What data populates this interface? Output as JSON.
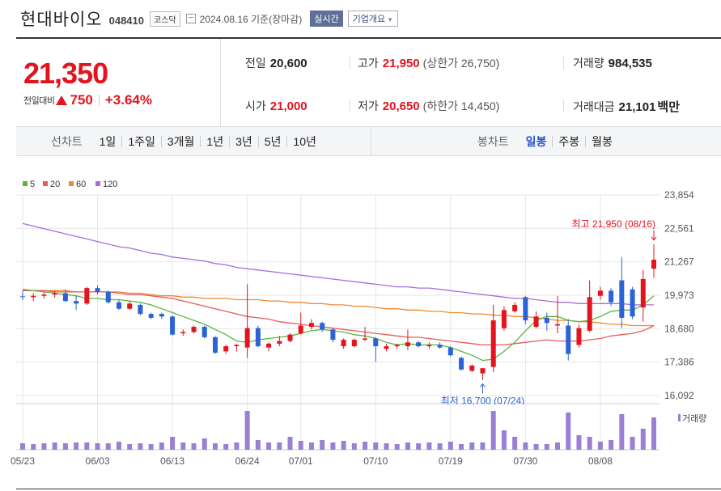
{
  "header": {
    "name": "현대바이오",
    "code": "048410",
    "market": "코스닥",
    "date": "2024.08.16 기준(장마감)",
    "realtime_label": "실시간",
    "info_label": "기업개요",
    "calendar_icon": "calendar-icon"
  },
  "quote": {
    "price": "21,350",
    "change_label": "전일대비",
    "change_icon": "up-triangle-icon",
    "change_amount": "750",
    "change_pct": "+3.64%",
    "prev_close_label": "전일",
    "prev_close": "20,600",
    "high_label": "고가",
    "high": "21,950",
    "upper_limit": "(상한가 26,750)",
    "volume_label": "거래량",
    "volume": "984,535",
    "open_label": "시가",
    "open": "21,000",
    "low_label": "저가",
    "low": "20,650",
    "lower_limit": "(하한가 14,450)",
    "amount_label": "거래대금",
    "amount": "21,101",
    "amount_unit": "백만",
    "up_color": "#e3141e"
  },
  "period": {
    "line_label": "선차트",
    "line_items": [
      "1일",
      "1주일",
      "3개월",
      "1년",
      "3년",
      "5년",
      "10년"
    ],
    "candle_label": "봉차트",
    "candle_items": [
      "일봉",
      "주봉",
      "월봉"
    ],
    "active": "일봉"
  },
  "chart_data": {
    "type": "candlestick",
    "legend": [
      {
        "name": "5",
        "color": "#5ab540"
      },
      {
        "name": "20",
        "color": "#e8595b"
      },
      {
        "name": "60",
        "color": "#f08a2e"
      },
      {
        "name": "120",
        "color": "#a46fd8"
      }
    ],
    "y_ticks": [
      "23,854",
      "22,561",
      "21,267",
      "19,973",
      "18,680",
      "17,386",
      "16,092"
    ],
    "ylim": [
      16092,
      23854
    ],
    "x_ticks": [
      {
        "label": "05/23",
        "index": 0
      },
      {
        "label": "06/03",
        "index": 7
      },
      {
        "label": "06/13",
        "index": 14
      },
      {
        "label": "06/24",
        "index": 21
      },
      {
        "label": "07/01",
        "index": 26
      },
      {
        "label": "07/10",
        "index": 33
      },
      {
        "label": "07/19",
        "index": 40
      },
      {
        "label": "07/30",
        "index": 47
      },
      {
        "label": "08/08",
        "index": 54
      }
    ],
    "annotations": {
      "high": {
        "text": "최고 21,950 (08/16)",
        "index": 59,
        "value": 21950
      },
      "low": {
        "text": "최저 16,700 (07/24)",
        "index": 43,
        "value": 16700
      }
    },
    "up_color": "#e3141e",
    "down_color": "#2b63d6",
    "volume_label": "거래량",
    "candles": [
      {
        "o": 19930,
        "h": 20150,
        "l": 19780,
        "c": 19900
      },
      {
        "o": 19900,
        "h": 20050,
        "l": 19750,
        "c": 19950
      },
      {
        "o": 19950,
        "h": 20100,
        "l": 19850,
        "c": 20000
      },
      {
        "o": 20000,
        "h": 20150,
        "l": 19880,
        "c": 20050
      },
      {
        "o": 20050,
        "h": 20200,
        "l": 19700,
        "c": 19750
      },
      {
        "o": 19750,
        "h": 19950,
        "l": 19400,
        "c": 19650
      },
      {
        "o": 19650,
        "h": 20300,
        "l": 19600,
        "c": 20250
      },
      {
        "o": 20250,
        "h": 20350,
        "l": 20000,
        "c": 20100
      },
      {
        "o": 20100,
        "h": 20150,
        "l": 19650,
        "c": 19700
      },
      {
        "o": 19700,
        "h": 19800,
        "l": 19400,
        "c": 19450
      },
      {
        "o": 19450,
        "h": 19750,
        "l": 19400,
        "c": 19650
      },
      {
        "o": 19600,
        "h": 19650,
        "l": 19200,
        "c": 19250
      },
      {
        "o": 19250,
        "h": 19300,
        "l": 19050,
        "c": 19100
      },
      {
        "o": 19250,
        "h": 19300,
        "l": 19050,
        "c": 19150
      },
      {
        "o": 19150,
        "h": 19200,
        "l": 18400,
        "c": 18450
      },
      {
        "o": 18500,
        "h": 18650,
        "l": 18400,
        "c": 18550
      },
      {
        "o": 18550,
        "h": 18800,
        "l": 18500,
        "c": 18750
      },
      {
        "o": 18750,
        "h": 18800,
        "l": 18300,
        "c": 18350
      },
      {
        "o": 18350,
        "h": 18400,
        "l": 17700,
        "c": 17750
      },
      {
        "o": 17800,
        "h": 18050,
        "l": 17700,
        "c": 18000
      },
      {
        "o": 18000,
        "h": 18100,
        "l": 17800,
        "c": 18050
      },
      {
        "o": 17950,
        "h": 20400,
        "l": 17550,
        "c": 18700
      },
      {
        "o": 18700,
        "h": 18800,
        "l": 17950,
        "c": 18000
      },
      {
        "o": 17950,
        "h": 18150,
        "l": 17800,
        "c": 18100
      },
      {
        "o": 18100,
        "h": 18400,
        "l": 18000,
        "c": 18200
      },
      {
        "o": 18200,
        "h": 18500,
        "l": 18150,
        "c": 18450
      },
      {
        "o": 18500,
        "h": 19300,
        "l": 18450,
        "c": 18800
      },
      {
        "o": 18750,
        "h": 19050,
        "l": 18650,
        "c": 18900
      },
      {
        "o": 18900,
        "h": 18950,
        "l": 18550,
        "c": 18650
      },
      {
        "o": 18650,
        "h": 18700,
        "l": 18150,
        "c": 18250
      },
      {
        "o": 18000,
        "h": 18300,
        "l": 17900,
        "c": 18250
      },
      {
        "o": 18000,
        "h": 18300,
        "l": 17950,
        "c": 18250
      },
      {
        "o": 18250,
        "h": 18750,
        "l": 18200,
        "c": 18300
      },
      {
        "o": 18300,
        "h": 18350,
        "l": 17400,
        "c": 18000
      },
      {
        "o": 17900,
        "h": 18100,
        "l": 17800,
        "c": 18000
      },
      {
        "o": 18000,
        "h": 18100,
        "l": 17900,
        "c": 18050
      },
      {
        "o": 18000,
        "h": 18650,
        "l": 17850,
        "c": 18150
      },
      {
        "o": 18150,
        "h": 18200,
        "l": 17950,
        "c": 18000
      },
      {
        "o": 18000,
        "h": 18150,
        "l": 17900,
        "c": 18050
      },
      {
        "o": 18050,
        "h": 18150,
        "l": 17900,
        "c": 17950
      },
      {
        "o": 17950,
        "h": 18000,
        "l": 17600,
        "c": 17650
      },
      {
        "o": 17550,
        "h": 17600,
        "l": 17050,
        "c": 17100
      },
      {
        "o": 17050,
        "h": 17300,
        "l": 17000,
        "c": 17250
      },
      {
        "o": 16950,
        "h": 17150,
        "l": 16700,
        "c": 17150
      },
      {
        "o": 17200,
        "h": 19600,
        "l": 17000,
        "c": 19000
      },
      {
        "o": 18700,
        "h": 19550,
        "l": 18600,
        "c": 19400
      },
      {
        "o": 19350,
        "h": 19700,
        "l": 19300,
        "c": 19600
      },
      {
        "o": 19900,
        "h": 19950,
        "l": 18850,
        "c": 19000
      },
      {
        "o": 18750,
        "h": 19350,
        "l": 18700,
        "c": 19150
      },
      {
        "o": 19100,
        "h": 19300,
        "l": 18600,
        "c": 18900
      },
      {
        "o": 18800,
        "h": 19950,
        "l": 18500,
        "c": 18850
      },
      {
        "o": 18800,
        "h": 19050,
        "l": 17450,
        "c": 17700
      },
      {
        "o": 18050,
        "h": 18850,
        "l": 17950,
        "c": 18700
      },
      {
        "o": 18600,
        "h": 20550,
        "l": 18550,
        "c": 19900
      },
      {
        "o": 19950,
        "h": 20300,
        "l": 19800,
        "c": 20150
      },
      {
        "o": 20150,
        "h": 20250,
        "l": 19550,
        "c": 19700
      },
      {
        "o": 20550,
        "h": 21450,
        "l": 18700,
        "c": 19100
      },
      {
        "o": 20200,
        "h": 20300,
        "l": 19050,
        "c": 19150
      },
      {
        "o": 19500,
        "h": 20950,
        "l": 18950,
        "c": 20600
      },
      {
        "o": 21000,
        "h": 21950,
        "l": 20650,
        "c": 21350
      }
    ],
    "ma5": [
      20200,
      20150,
      20100,
      20050,
      20000,
      19950,
      19850,
      19850,
      19800,
      19800,
      19750,
      19700,
      19600,
      19450,
      19300,
      19150,
      19000,
      18850,
      18650,
      18450,
      18200,
      18150,
      18250,
      18300,
      18350,
      18400,
      18500,
      18600,
      18650,
      18600,
      18550,
      18450,
      18400,
      18300,
      18150,
      18050,
      18100,
      18050,
      18050,
      18050,
      17950,
      17800,
      17650,
      17450,
      17500,
      17800,
      18150,
      18600,
      19000,
      19150,
      19150,
      19000,
      18950,
      19000,
      19150,
      19350,
      19400,
      19400,
      19600,
      19950
    ],
    "ma20": [
      20150,
      20150,
      20150,
      20100,
      20100,
      20100,
      20100,
      20100,
      20100,
      20050,
      20000,
      20000,
      19950,
      19900,
      19850,
      19750,
      19650,
      19550,
      19450,
      19350,
      19250,
      19150,
      19100,
      19050,
      18950,
      18900,
      18850,
      18800,
      18750,
      18700,
      18650,
      18600,
      18550,
      18500,
      18450,
      18400,
      18350,
      18350,
      18300,
      18250,
      18200,
      18150,
      18100,
      18050,
      18050,
      18050,
      18100,
      18150,
      18200,
      18250,
      18200,
      18200,
      18200,
      18250,
      18300,
      18400,
      18450,
      18500,
      18600,
      18800
    ],
    "ma60": [
      20150,
      20150,
      20150,
      20150,
      20150,
      20100,
      20100,
      20100,
      20100,
      20100,
      20050,
      20050,
      20000,
      19950,
      19950,
      19900,
      19900,
      19850,
      19850,
      19850,
      19800,
      19800,
      19800,
      19750,
      19750,
      19700,
      19700,
      19650,
      19650,
      19600,
      19600,
      19550,
      19550,
      19500,
      19450,
      19450,
      19400,
      19400,
      19350,
      19350,
      19300,
      19300,
      19250,
      19250,
      19200,
      19200,
      19150,
      19150,
      19100,
      19050,
      19000,
      19000,
      18950,
      18950,
      18900,
      18850,
      18850,
      18800,
      18800,
      18800
    ],
    "ma120": [
      22750,
      22650,
      22550,
      22450,
      22350,
      22250,
      22150,
      22050,
      21950,
      21850,
      21800,
      21700,
      21600,
      21550,
      21450,
      21400,
      21350,
      21300,
      21200,
      21150,
      21050,
      21000,
      20950,
      20900,
      20850,
      20800,
      20750,
      20700,
      20650,
      20600,
      20550,
      20500,
      20450,
      20400,
      20350,
      20300,
      20300,
      20250,
      20250,
      20200,
      20150,
      20100,
      20050,
      20000,
      19950,
      19900,
      19850,
      19850,
      19800,
      19750,
      19700,
      19700,
      19650,
      19650,
      19650,
      19650,
      19650,
      19600,
      19600,
      19600
    ],
    "volume": [
      8,
      7,
      8,
      9,
      8,
      9,
      9,
      8,
      8,
      10,
      7,
      8,
      7,
      9,
      16,
      9,
      8,
      14,
      8,
      7,
      9,
      48,
      12,
      9,
      9,
      16,
      11,
      9,
      12,
      9,
      11,
      8,
      10,
      9,
      8,
      7,
      9,
      8,
      9,
      8,
      10,
      7,
      9,
      9,
      48,
      24,
      16,
      9,
      7,
      7,
      9,
      46,
      18,
      16,
      10,
      12,
      44,
      16,
      26,
      40
    ]
  }
}
